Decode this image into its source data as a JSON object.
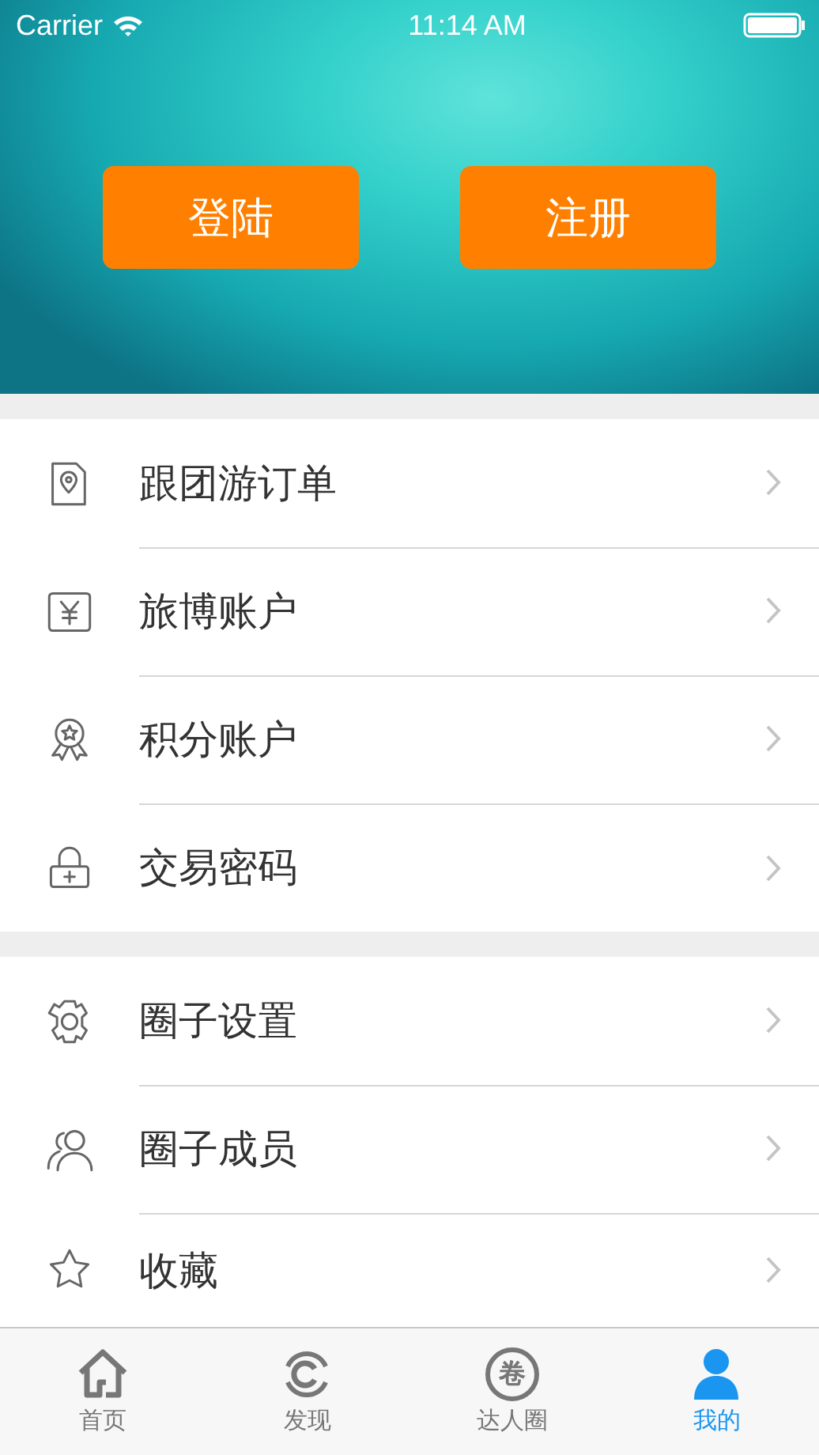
{
  "status_bar": {
    "carrier": "Carrier",
    "time": "11:14 AM"
  },
  "header": {
    "buttons": [
      {
        "label": "登陆"
      },
      {
        "label": "注册"
      }
    ]
  },
  "menu_groups": [
    {
      "items": [
        {
          "label": "跟团游订单"
        },
        {
          "label": "旅博账户"
        },
        {
          "label": "积分账户"
        },
        {
          "label": "交易密码"
        }
      ]
    },
    {
      "items": [
        {
          "label": "圈子设置"
        },
        {
          "label": "圈子成员"
        },
        {
          "label": "收藏"
        }
      ]
    }
  ],
  "tab_bar": [
    {
      "label": "首页",
      "selected": false
    },
    {
      "label": "发现",
      "selected": false
    },
    {
      "label": "达人圈",
      "glyph": "卷",
      "selected": false
    },
    {
      "label": "我的",
      "selected": true
    }
  ]
}
